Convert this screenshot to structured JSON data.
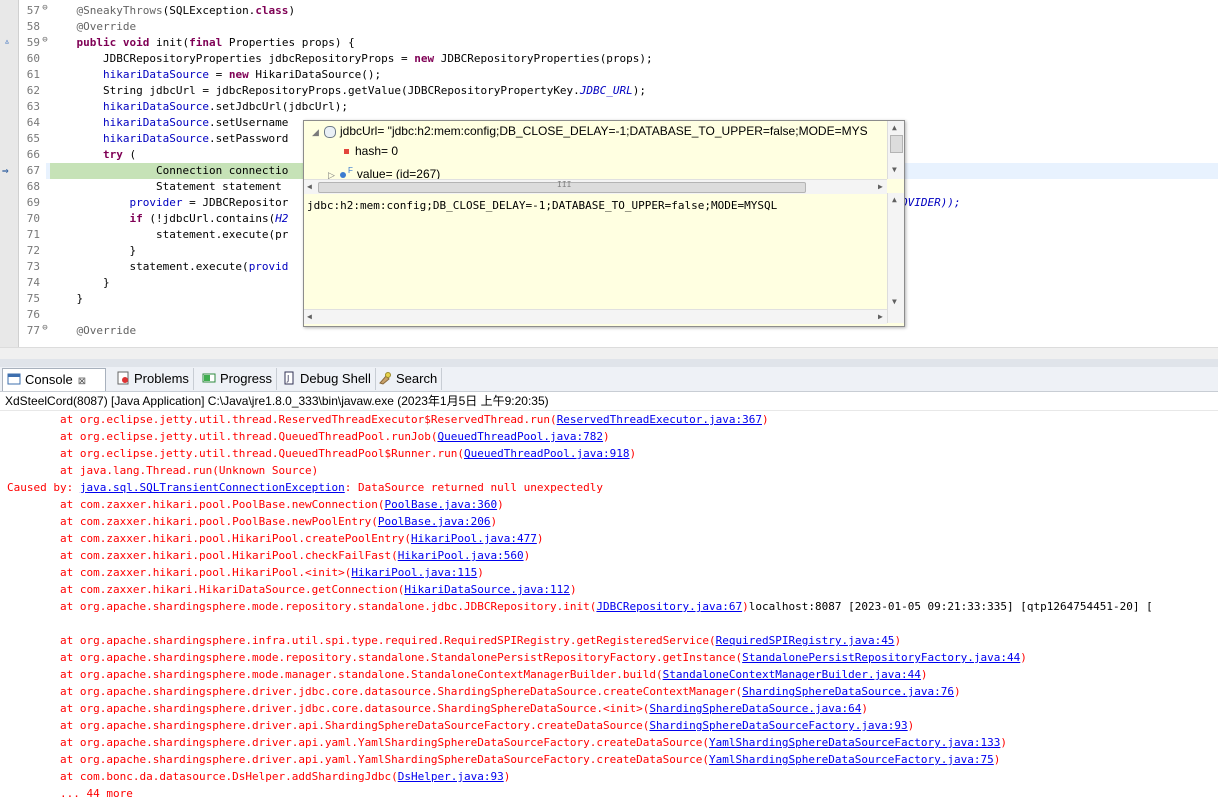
{
  "editor": {
    "lines": [
      {
        "num": "57",
        "segments": [
          {
            "t": "    "
          },
          {
            "t": "@SneakyThrows",
            "c": "ann"
          },
          {
            "t": "(SQLException."
          },
          {
            "t": "class",
            "c": "kw"
          },
          {
            "t": ")"
          }
        ]
      },
      {
        "num": "58",
        "segments": [
          {
            "t": "    "
          },
          {
            "t": "@Override",
            "c": "ann"
          }
        ]
      },
      {
        "num": "59",
        "segments": [
          {
            "t": "    "
          },
          {
            "t": "public",
            "c": "kw"
          },
          {
            "t": " "
          },
          {
            "t": "void",
            "c": "kw"
          },
          {
            "t": " init("
          },
          {
            "t": "final",
            "c": "kw"
          },
          {
            "t": " Properties props) {"
          }
        ]
      },
      {
        "num": "60",
        "segments": [
          {
            "t": "        JDBCRepositoryProperties jdbcRepositoryProps = "
          },
          {
            "t": "new",
            "c": "kw"
          },
          {
            "t": " JDBCRepositoryProperties(props);"
          }
        ]
      },
      {
        "num": "61",
        "segments": [
          {
            "t": "        "
          },
          {
            "t": "hikariDataSource",
            "c": "fld"
          },
          {
            "t": " = "
          },
          {
            "t": "new",
            "c": "kw"
          },
          {
            "t": " HikariDataSource();"
          }
        ]
      },
      {
        "num": "62",
        "segments": [
          {
            "t": "        String jdbcUrl = jdbcRepositoryProps.getValue(JDBCRepositoryPropertyKey."
          },
          {
            "t": "JDBC_URL",
            "c": "stc"
          },
          {
            "t": ");"
          }
        ]
      },
      {
        "num": "63",
        "segments": [
          {
            "t": "        "
          },
          {
            "t": "hikariDataSource",
            "c": "fld"
          },
          {
            "t": ".setJdbcUrl(jdbcUrl);"
          }
        ]
      },
      {
        "num": "64",
        "segments": [
          {
            "t": "        "
          },
          {
            "t": "hikariDataSource",
            "c": "fld"
          },
          {
            "t": ".setUsername"
          }
        ]
      },
      {
        "num": "65",
        "segments": [
          {
            "t": "        "
          },
          {
            "t": "hikariDataSource",
            "c": "fld"
          },
          {
            "t": ".setPassword"
          }
        ]
      },
      {
        "num": "66",
        "segments": [
          {
            "t": "        "
          },
          {
            "t": "try",
            "c": "kw"
          },
          {
            "t": " ("
          }
        ]
      },
      {
        "num": "67",
        "segments": [
          {
            "t": "                Connection connectio"
          }
        ]
      },
      {
        "num": "68",
        "segments": [
          {
            "t": "                Statement statement "
          }
        ]
      },
      {
        "num": "69",
        "segments": [
          {
            "t": "            "
          },
          {
            "t": "provider",
            "c": "fld"
          },
          {
            "t": " = JDBCRepositor"
          }
        ]
      },
      {
        "num": "70",
        "segments": [
          {
            "t": "            "
          },
          {
            "t": "if",
            "c": "kw"
          },
          {
            "t": " (!jdbcUrl.contains("
          },
          {
            "t": "H2",
            "c": "stc"
          }
        ]
      },
      {
        "num": "71",
        "segments": [
          {
            "t": "                statement.execute(pr"
          }
        ]
      },
      {
        "num": "72",
        "segments": [
          {
            "t": "            }"
          }
        ]
      },
      {
        "num": "73",
        "segments": [
          {
            "t": "            statement.execute("
          },
          {
            "t": "provid",
            "c": "fld"
          }
        ]
      },
      {
        "num": "74",
        "segments": [
          {
            "t": "        }"
          }
        ]
      },
      {
        "num": "75",
        "segments": [
          {
            "t": "    }"
          }
        ]
      },
      {
        "num": "76",
        "segments": [
          {
            "t": ""
          }
        ]
      },
      {
        "num": "77",
        "segments": [
          {
            "t": "    "
          },
          {
            "t": "@Override",
            "c": "ann"
          }
        ]
      }
    ],
    "line69_tail": "OVIDER));"
  },
  "popup": {
    "root": "jdbcUrl= \"jdbc:h2:mem:config;DB_CLOSE_DELAY=-1;DATABASE_TO_UPPER=false;MODE=MYS",
    "child1": "hash= 0",
    "child2": "value= (id=267)",
    "detail": "jdbc:h2:mem:config;DB_CLOSE_DELAY=-1;DATABASE_TO_UPPER=false;MODE=MYSQL"
  },
  "tabs": [
    {
      "label": "Console",
      "active": true
    },
    {
      "label": "Problems"
    },
    {
      "label": "Progress"
    },
    {
      "label": "Debug Shell"
    },
    {
      "label": "Search"
    }
  ],
  "console": {
    "header": "XdSteelCord(8087) [Java Application] C:\\Java\\jre1.8.0_333\\bin\\javaw.exe (2023年1月5日 上午9:20:35)",
    "lines": [
      {
        "pre": "        at org.eclipse.jetty.util.thread.ReservedThreadExecutor$ReservedThread.run(",
        "link": "ReservedThreadExecutor.java:367",
        "post": ")"
      },
      {
        "pre": "        at org.eclipse.jetty.util.thread.QueuedThreadPool.runJob(",
        "link": "QueuedThreadPool.java:782",
        "post": ")"
      },
      {
        "pre": "        at org.eclipse.jetty.util.thread.QueuedThreadPool$Runner.run(",
        "link": "QueuedThreadPool.java:918",
        "post": ")"
      },
      {
        "pre": "        at java.lang.Thread.run(Unknown Source)",
        "link": "",
        "post": ""
      },
      {
        "pre": "Caused by: ",
        "link": "java.sql.SQLTransientConnectionException",
        "post": ": DataSource returned null unexpectedly"
      },
      {
        "pre": "        at com.zaxxer.hikari.pool.PoolBase.newConnection(",
        "link": "PoolBase.java:360",
        "post": ")"
      },
      {
        "pre": "        at com.zaxxer.hikari.pool.PoolBase.newPoolEntry(",
        "link": "PoolBase.java:206",
        "post": ")"
      },
      {
        "pre": "        at com.zaxxer.hikari.pool.HikariPool.createPoolEntry(",
        "link": "HikariPool.java:477",
        "post": ")"
      },
      {
        "pre": "        at com.zaxxer.hikari.pool.HikariPool.checkFailFast(",
        "link": "HikariPool.java:560",
        "post": ")"
      },
      {
        "pre": "        at com.zaxxer.hikari.pool.HikariPool.<init>(",
        "link": "HikariPool.java:115",
        "post": ")"
      },
      {
        "pre": "        at com.zaxxer.hikari.HikariDataSource.getConnection(",
        "link": "HikariDataSource.java:112",
        "post": ")"
      },
      {
        "pre": "        at org.apache.shardingsphere.mode.repository.standalone.jdbc.JDBCRepository.init(",
        "link": "JDBCRepository.java:67",
        "post": ")",
        "black": "localhost:8087 [2023-01-05 09:21:33:335] [qtp1264754451-20] ["
      },
      {
        "pre": "",
        "link": "",
        "post": ""
      },
      {
        "pre": "        at org.apache.shardingsphere.infra.util.spi.type.required.RequiredSPIRegistry.getRegisteredService(",
        "link": "RequiredSPIRegistry.java:45",
        "post": ")"
      },
      {
        "pre": "        at org.apache.shardingsphere.mode.repository.standalone.StandalonePersistRepositoryFactory.getInstance(",
        "link": "StandalonePersistRepositoryFactory.java:44",
        "post": ")"
      },
      {
        "pre": "        at org.apache.shardingsphere.mode.manager.standalone.StandaloneContextManagerBuilder.build(",
        "link": "StandaloneContextManagerBuilder.java:44",
        "post": ")"
      },
      {
        "pre": "        at org.apache.shardingsphere.driver.jdbc.core.datasource.ShardingSphereDataSource.createContextManager(",
        "link": "ShardingSphereDataSource.java:76",
        "post": ")"
      },
      {
        "pre": "        at org.apache.shardingsphere.driver.jdbc.core.datasource.ShardingSphereDataSource.<init>(",
        "link": "ShardingSphereDataSource.java:64",
        "post": ")"
      },
      {
        "pre": "        at org.apache.shardingsphere.driver.api.ShardingSphereDataSourceFactory.createDataSource(",
        "link": "ShardingSphereDataSourceFactory.java:93",
        "post": ")"
      },
      {
        "pre": "        at org.apache.shardingsphere.driver.api.yaml.YamlShardingSphereDataSourceFactory.createDataSource(",
        "link": "YamlShardingSphereDataSourceFactory.java:133",
        "post": ")"
      },
      {
        "pre": "        at org.apache.shardingsphere.driver.api.yaml.YamlShardingSphereDataSourceFactory.createDataSource(",
        "link": "YamlShardingSphereDataSourceFactory.java:75",
        "post": ")"
      },
      {
        "pre": "        at com.bonc.da.datasource.DsHelper.addShardingJdbc(",
        "link": "DsHelper.java:93",
        "post": ")"
      },
      {
        "pre": "        ... 44 more",
        "link": "",
        "post": ""
      }
    ]
  },
  "colors": {
    "keyword": "#7f0055",
    "annotation": "#646464",
    "field": "#0000c0",
    "error": "#ff0000",
    "link": "#0000ee",
    "popupBg": "#ffffe1",
    "currentLine": "#c6e2b7"
  },
  "icons": {
    "console": "console-icon",
    "problems": "problems-icon",
    "progress": "progress-icon",
    "debugShell": "debug-shell-icon",
    "search": "search-icon"
  }
}
